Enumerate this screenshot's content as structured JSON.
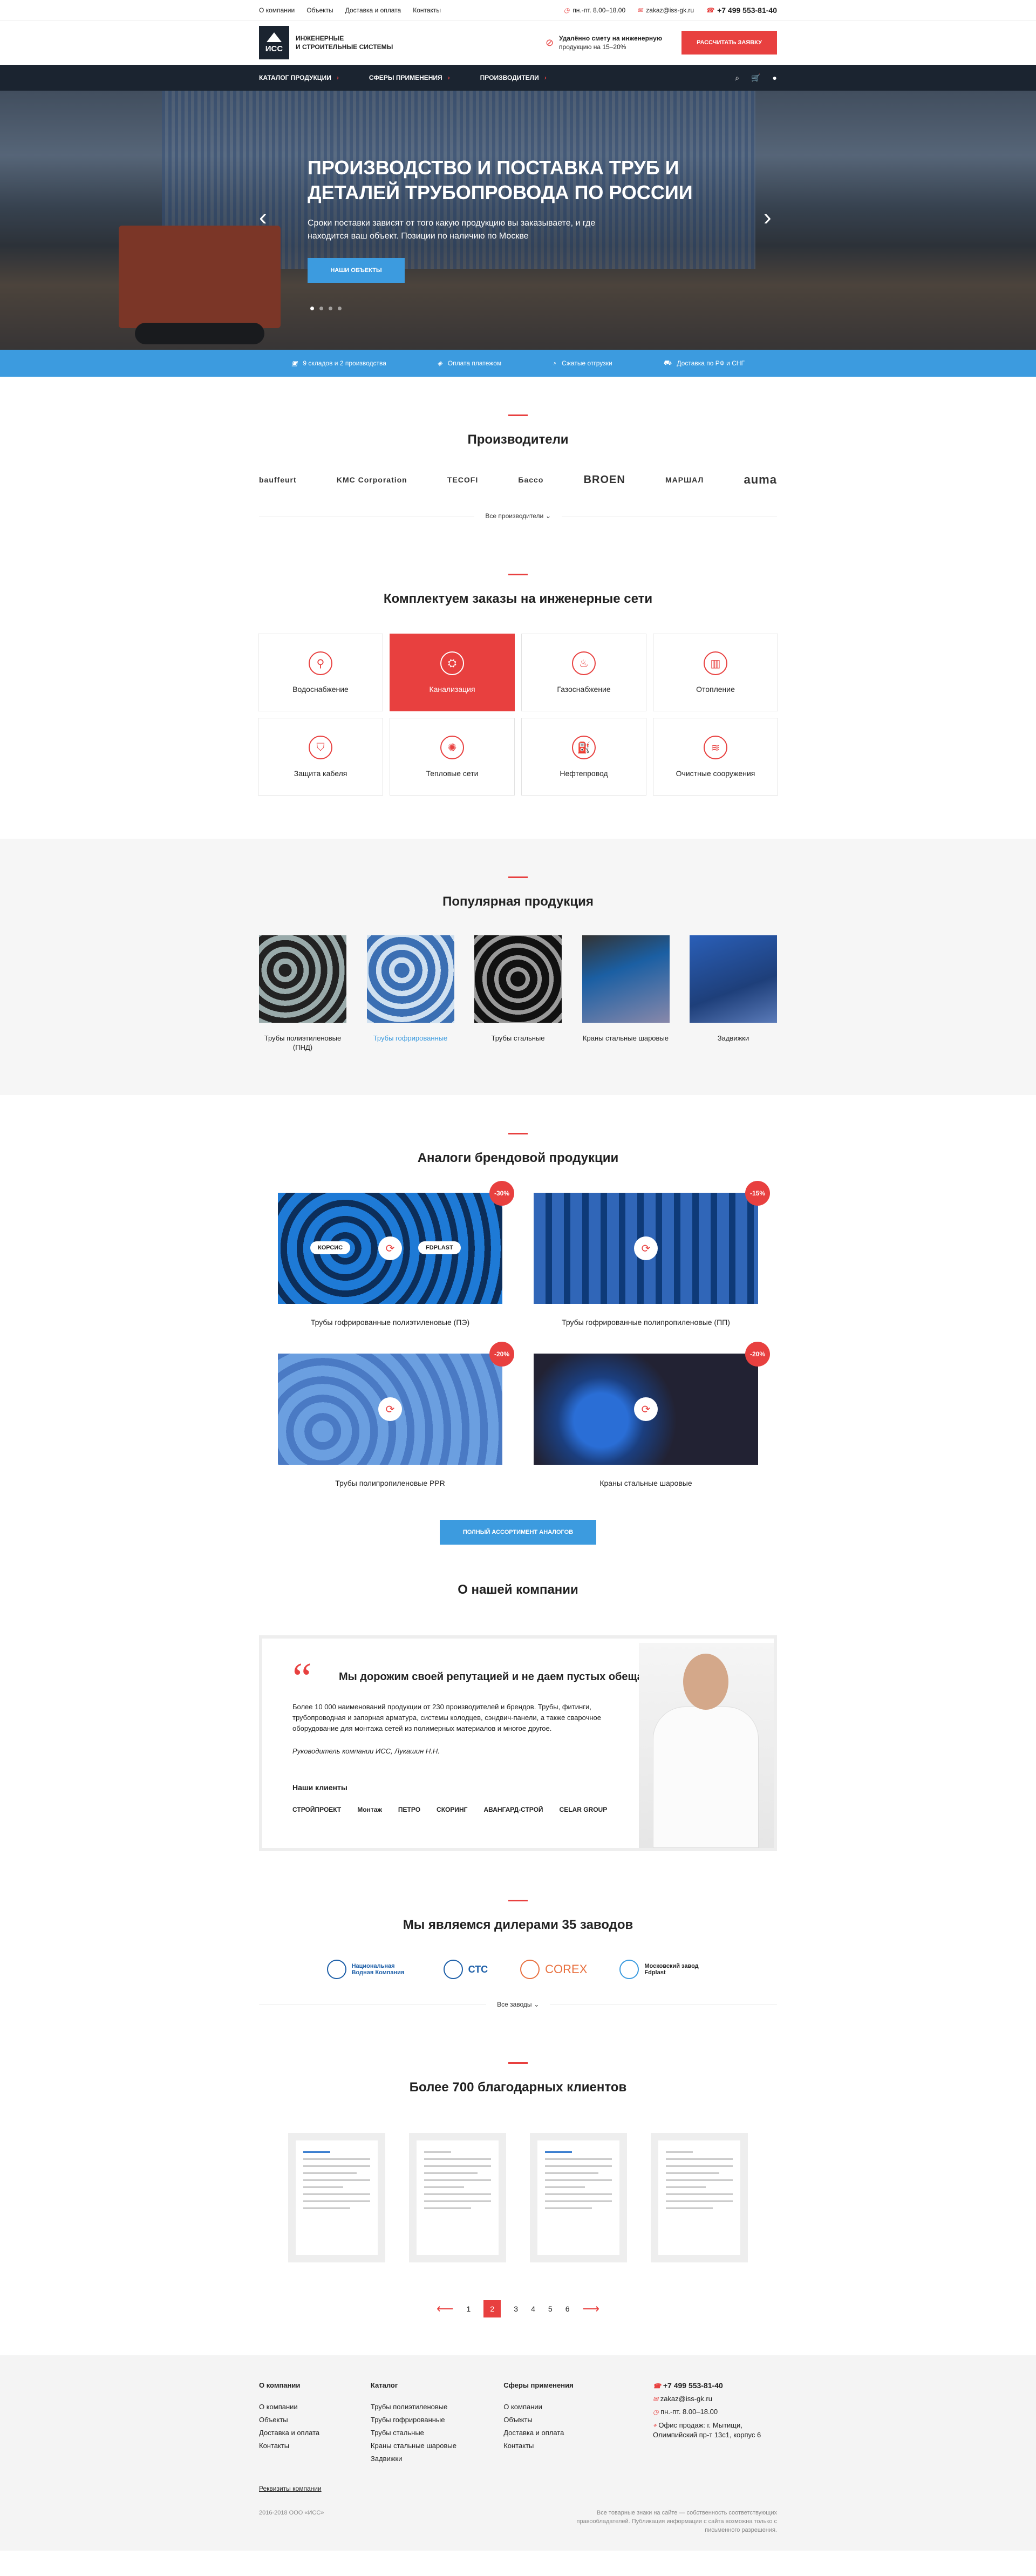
{
  "topbar": {
    "links": [
      "О компании",
      "Объекты",
      "Доставка и оплата",
      "Контакты"
    ],
    "hours": "пн.-пт. 8.00–18.00",
    "email": "zakaz@iss-gk.ru",
    "phone": "+7 499 553-81-40"
  },
  "header": {
    "logo_abbr": "ИСС",
    "logo_text": [
      "Инженерные",
      "и строительные системы"
    ],
    "estimate": [
      "Удалённо смету на инженерную",
      "продукцию на 15–20%"
    ],
    "cta": "Рассчитать заявку"
  },
  "nav": {
    "items": [
      "Каталог продукции",
      "Сферы применения",
      "Производители"
    ]
  },
  "hero": {
    "title": "Производство и поставка труб и деталей трубопровода по России",
    "text": "Сроки поставки зависят от того какую продукцию вы заказываете, и где находится ваш объект. Позиции по наличию по Москве",
    "button": "Наши объекты"
  },
  "strip": [
    "9 складов и 2 производства",
    "Оплата платежом",
    "Сжатые отгрузки",
    "Доставка по РФ и СНГ"
  ],
  "manufacturers": {
    "title": "Производители",
    "brands": [
      "bauffeurt",
      "KMC Corporation",
      "TECOFI",
      "Бассо",
      "BROEN",
      "МАРШАЛ",
      "auma"
    ],
    "more": "Все производители"
  },
  "networks": {
    "title": "Комплектуем заказы на инженерные сети",
    "items": [
      "Водоснабжение",
      "Канализация",
      "Газоснабжение",
      "Отопление",
      "Защита кабеля",
      "Тепловые сети",
      "Нефтепровод",
      "Очистные сооружения"
    ]
  },
  "popular": {
    "title": "Популярная продукция",
    "items": [
      "Трубы полиэтиленовые (ПНД)",
      "Трубы гофрированные",
      "Трубы стальные",
      "Краны стальные шаровые",
      "Задвижки"
    ]
  },
  "analogs": {
    "title": "Аналоги брендовой продукции",
    "items": [
      {
        "name": "Трубы гофрированные полиэтиленовые (ПЭ)",
        "badge": "-30%",
        "tags": [
          "КОРСИС",
          "FDPLAST"
        ]
      },
      {
        "name": "Трубы гофрированные полипропиленовые (ПП)",
        "badge": "-15%"
      },
      {
        "name": "Трубы полипропиленовые PPR",
        "badge": "-20%"
      },
      {
        "name": "Краны стальные шаровые",
        "badge": "-20%"
      }
    ],
    "button": "Полный ассортимент аналогов"
  },
  "about": {
    "title": "О нашей компании",
    "heading": "Мы дорожим своей репутацией и не даем пустых обещаний",
    "text": "Более 10 000 наименований продукции от 230 производителей и брендов. Трубы, фитинги, трубопроводная и запорная арматура, системы колодцев, сэндвич-панели, а также сварочное оборудование для монтажа сетей из полимерных материалов и многое другое.",
    "signature": "Руководитель компании ИСС, Лукашин Н.Н.",
    "clients_title": "Наши клиенты",
    "clients": [
      "СТРОЙПРОЕКТ",
      "Монтаж",
      "ПЕТРО",
      "СКОРИНГ",
      "АВАНГАРД-СТРОЙ",
      "CELAR GROUP"
    ]
  },
  "dealers": {
    "title": "Мы являемся дилерами 35 заводов",
    "items": [
      "Национальная Водная Компания",
      "СТС",
      "COREX",
      "Московский завод Fdplast"
    ],
    "more": "Все заводы"
  },
  "letters": {
    "title": "Более 700 благодарных клиентов",
    "pages": [
      "1",
      "2",
      "3",
      "4",
      "5",
      "6"
    ]
  },
  "footer": {
    "col1": {
      "title": "О компании",
      "items": [
        "О компании",
        "Объекты",
        "Доставка и оплата",
        "Контакты"
      ]
    },
    "col2": {
      "title": "Каталог",
      "items": [
        "Трубы полиэтиленовые",
        "Трубы гофрированные",
        "Трубы стальные",
        "Краны стальные шаровые",
        "Задвижки"
      ]
    },
    "col3": {
      "title": "Сферы применения",
      "items": [
        "О компании",
        "Объекты",
        "Доставка и оплата",
        "Контакты"
      ]
    },
    "phone": "+7 499 553-81-40",
    "email": "zakaz@iss-gk.ru",
    "hours": "пн.-пт. 8.00–18.00",
    "address": "Офис продаж: г. Мытищи, Олимпийский пр-т 13с1, корпус 6",
    "requisites": "Реквизиты компании",
    "copyright": "2016-2018 ООО «ИСС»",
    "disclaimer": "Все товарные знаки на сайте — собственность соответствующих правообладателей. Публикация информации с сайта возможна только с письменного разрешения."
  },
  "colors": {
    "accent": "#e8403f",
    "blue": "#3c9bdf",
    "dark": "#1b2430"
  }
}
